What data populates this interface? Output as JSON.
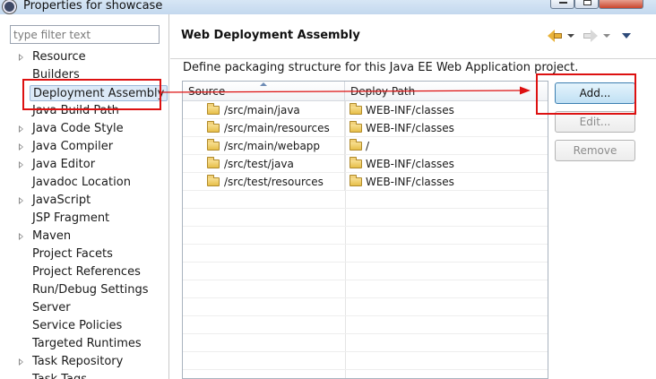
{
  "window": {
    "title": "Properties for showcase"
  },
  "filter": {
    "placeholder": "type filter text"
  },
  "nav": {
    "items": [
      {
        "label": "Resource",
        "expandable": true
      },
      {
        "label": "Builders",
        "expandable": false
      },
      {
        "label": "Deployment Assembly",
        "expandable": false,
        "selected": true
      },
      {
        "label": "Java Build Path",
        "expandable": false
      },
      {
        "label": "Java Code Style",
        "expandable": true
      },
      {
        "label": "Java Compiler",
        "expandable": true
      },
      {
        "label": "Java Editor",
        "expandable": true
      },
      {
        "label": "Javadoc Location",
        "expandable": false
      },
      {
        "label": "JavaScript",
        "expandable": true
      },
      {
        "label": "JSP Fragment",
        "expandable": false
      },
      {
        "label": "Maven",
        "expandable": true
      },
      {
        "label": "Project Facets",
        "expandable": false
      },
      {
        "label": "Project References",
        "expandable": false
      },
      {
        "label": "Run/Debug Settings",
        "expandable": false
      },
      {
        "label": "Server",
        "expandable": false
      },
      {
        "label": "Service Policies",
        "expandable": false
      },
      {
        "label": "Targeted Runtimes",
        "expandable": false
      },
      {
        "label": "Task Repository",
        "expandable": true
      },
      {
        "label": "Task Tags",
        "expandable": false
      }
    ]
  },
  "page": {
    "title": "Web Deployment Assembly",
    "description": "Define packaging structure for this Java EE Web Application project."
  },
  "table": {
    "columns": [
      "Source",
      "Deploy Path"
    ],
    "rows": [
      {
        "source": "/src/main/java",
        "deploy": "WEB-INF/classes"
      },
      {
        "source": "/src/main/resources",
        "deploy": "WEB-INF/classes"
      },
      {
        "source": "/src/main/webapp",
        "deploy": "/"
      },
      {
        "source": "/src/test/java",
        "deploy": "WEB-INF/classes"
      },
      {
        "source": "/src/test/resources",
        "deploy": "WEB-INF/classes"
      }
    ]
  },
  "buttons": {
    "add": "Add...",
    "edit": "Edit...",
    "remove": "Remove"
  },
  "colors": {
    "annotation": "#dd1111",
    "selection": "#dce9f7",
    "folder": "#e7bf4a"
  }
}
